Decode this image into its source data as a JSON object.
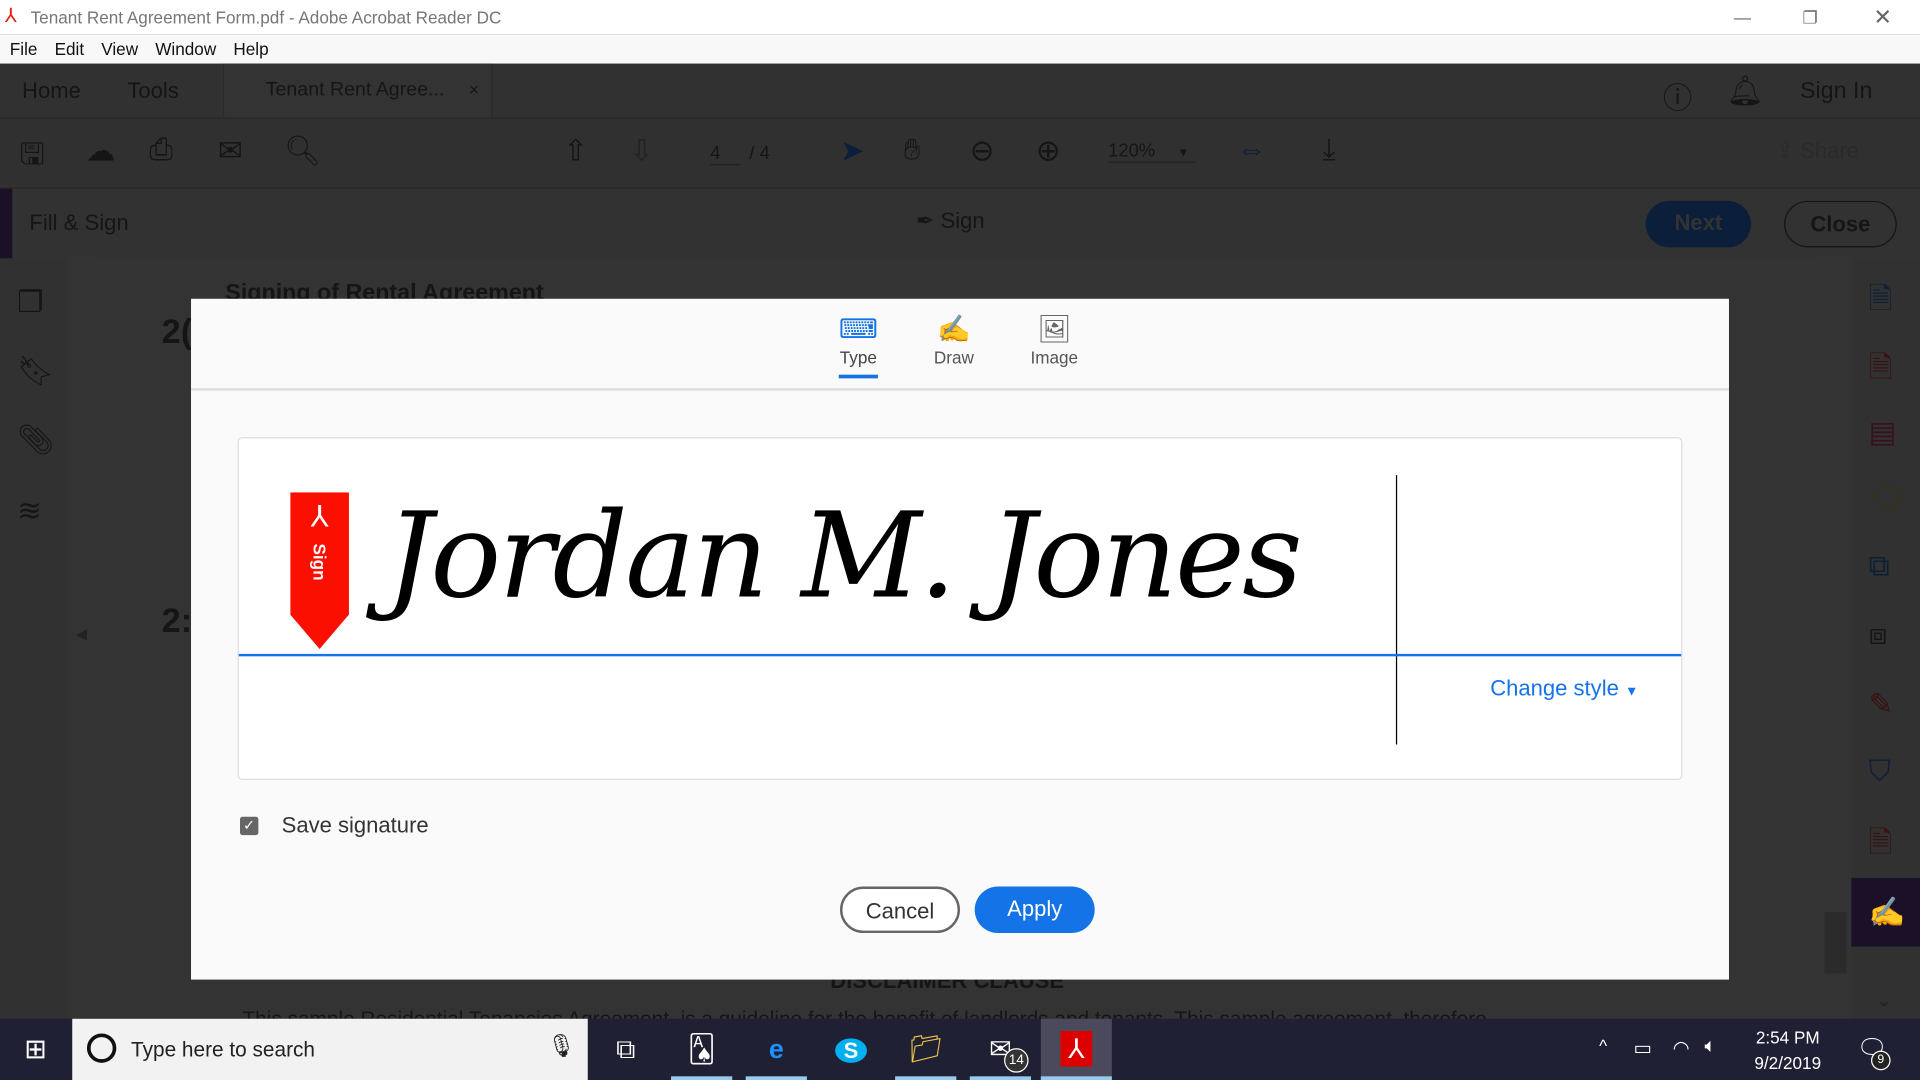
{
  "window": {
    "title": "Tenant Rent Agreement Form.pdf - Adobe Acrobat Reader DC"
  },
  "menu": [
    "File",
    "Edit",
    "View",
    "Window",
    "Help"
  ],
  "tabs": {
    "home": "Home",
    "tools": "Tools",
    "document": "Tenant Rent Agree...",
    "close": "×",
    "sign_in": "Sign In"
  },
  "toolbar": {
    "page_current": "4",
    "page_total": "/ 4",
    "zoom": "120%",
    "share": "Share"
  },
  "fill_sign": {
    "title": "Fill & Sign",
    "sign": "Sign",
    "next": "Next",
    "close": "Close"
  },
  "document": {
    "heading": "Signing of Rental Agreement",
    "num1": "2(",
    "num2": "2:",
    "disclaimer": "DISCLAIMER CLAUSE",
    "body": "This sample Residential Tenancies Agreement, is a guideline for the benefit of landlords and tenants. This sample agreement, therefore"
  },
  "dialog": {
    "tabs": [
      {
        "label": "Type",
        "active": true
      },
      {
        "label": "Draw",
        "active": false
      },
      {
        "label": "Image",
        "active": false
      }
    ],
    "badge": "Sign",
    "signature": "Jordan M. Jones",
    "change_style": "Change style",
    "save_signature": "Save signature",
    "save_checked": true,
    "cancel": "Cancel",
    "apply": "Apply"
  },
  "taskbar": {
    "search_placeholder": "Type here to search",
    "mail_badge": "14",
    "time": "2:54 PM",
    "date": "9/2/2019",
    "notif_badge": "9"
  },
  "colors": {
    "accent": "#1473e6",
    "adobe_red": "#fa0f00",
    "overlay": "#333333"
  }
}
